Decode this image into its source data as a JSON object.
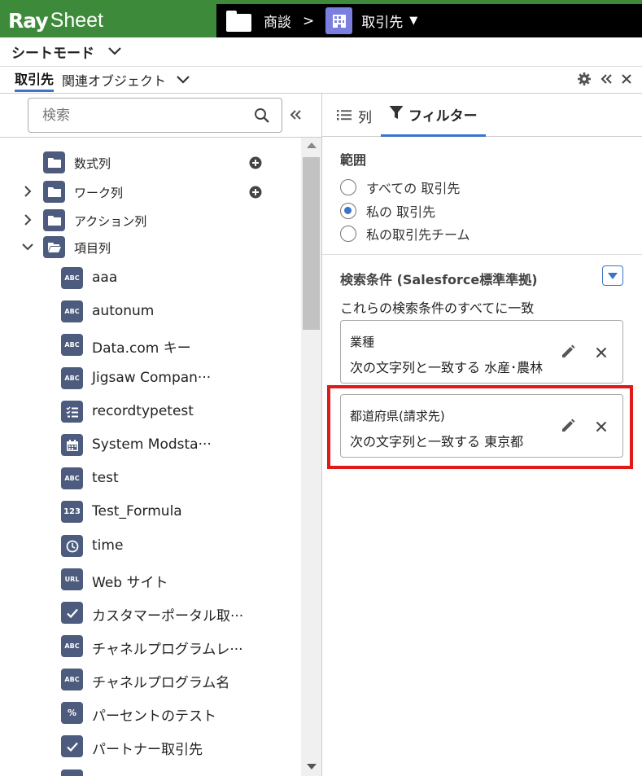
{
  "app": {
    "logo_ray": "Ray",
    "logo_sheet": "Sheet"
  },
  "breadcrumb": {
    "parent": "商談",
    "separator": ">",
    "current": "取引先"
  },
  "mode": {
    "label": "シートモード"
  },
  "tabs": {
    "active": "取引先",
    "related": "関連オブジェクト"
  },
  "search": {
    "placeholder": "検索"
  },
  "tree": {
    "folders": [
      {
        "label": "数式列"
      },
      {
        "label": "ワーク列"
      },
      {
        "label": "アクション列"
      },
      {
        "label": "項目列"
      }
    ],
    "items": [
      {
        "badge": "ABC",
        "label": "aaa"
      },
      {
        "badge": "ABC",
        "label": "autonum"
      },
      {
        "badge": "ABC",
        "label": "Data.com キー"
      },
      {
        "badge": "ABC",
        "label": "Jigsaw Compan···"
      },
      {
        "badge": "list",
        "label": "recordtypetest"
      },
      {
        "badge": "calendar",
        "label": "System Modsta···"
      },
      {
        "badge": "ABC",
        "label": "test"
      },
      {
        "badge": "123",
        "label": "Test_Formula"
      },
      {
        "badge": "clock",
        "label": "time"
      },
      {
        "badge": "URL",
        "label": "Web サイト"
      },
      {
        "badge": "check",
        "label": "カスタマーポータル取···"
      },
      {
        "badge": "ABC",
        "label": "チャネルプログラムレ···"
      },
      {
        "badge": "ABC",
        "label": "チャネルプログラム名"
      },
      {
        "badge": "%",
        "label": "パーセントのテスト"
      },
      {
        "badge": "check",
        "label": "パートナー取引先"
      }
    ]
  },
  "right_panel": {
    "tab_columns": "列",
    "tab_filter": "フィルター",
    "scope": {
      "title": "範囲",
      "options": [
        {
          "label": "すべての 取引先",
          "checked": false
        },
        {
          "label": "私の 取引先",
          "checked": true
        },
        {
          "label": "私の取引先チーム",
          "checked": false
        }
      ]
    },
    "conditions": {
      "title": "検索条件 (Salesforce標準準拠)",
      "subtitle": "これらの検索条件のすべてに一致",
      "filters": [
        {
          "field": "業種",
          "description": "次の文字列と一致する 水産･農林"
        },
        {
          "field": "都道府県(請求先)",
          "description": "次の文字列と一致する 東京都"
        }
      ]
    }
  },
  "colors": {
    "brand_green": "#3d8a3b",
    "accent_blue": "#3b74c9",
    "badge_navy": "#4d5c7e",
    "highlight_red": "#e11919",
    "object_icon": "#7b7fe0"
  }
}
